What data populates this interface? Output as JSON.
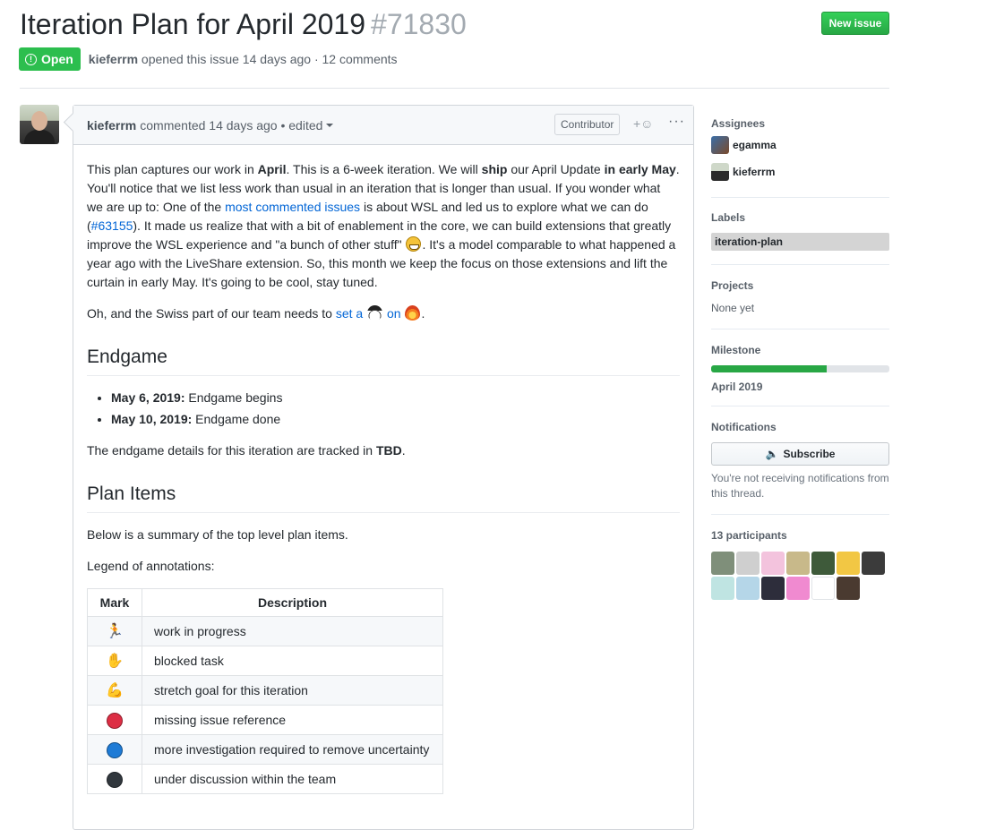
{
  "issue": {
    "title": "Iteration Plan for April 2019",
    "number": "#71830",
    "new_issue_label": "New issue",
    "state": "Open",
    "state_icon": "!",
    "author": "kieferrm",
    "opened_text": " opened this issue 14 days ago · 12 comments"
  },
  "comment": {
    "author": "kieferrm",
    "when": "commented 14 days ago • edited",
    "role_badge": "Contributor",
    "reaction_icon": "+☺",
    "menu_icon": "···",
    "p1": {
      "a": "This plan captures our work in ",
      "b": "April",
      "c": ". This is a 6-week iteration. We will ",
      "d": "ship",
      "e": " our April Update ",
      "f": "in early May",
      "g": ". You'll notice that we list less work than usual in an iteration that is longer than usual. If you wonder what we are up to: One of the ",
      "link1": "most commented issues",
      "h": " is about WSL and led us to explore what we can do (",
      "link2": "#63155",
      "i": "). It made us realize that with a bit of enablement in the core, we can build extensions that greatly improve the WSL experience and \"a bunch of other stuff\" ",
      "j": ". It's a model comparable to what happened a year ago with the LiveShare extension. So, this month we keep the focus on those extensions and lift the curtain in early May. It's going to be cool, stay tuned."
    },
    "p2": {
      "a": "Oh, and the Swiss part of our team needs to ",
      "link1": "set a",
      "link2": "on",
      "b": "."
    },
    "endgame_heading": "Endgame",
    "endgame_items": [
      {
        "date": "May 6, 2019:",
        "text": " Endgame begins"
      },
      {
        "date": "May 10, 2019:",
        "text": " Endgame done"
      }
    ],
    "endgame_note": {
      "a": "The endgame details for this iteration are tracked in ",
      "b": "TBD",
      "c": "."
    },
    "plan_heading": "Plan Items",
    "plan_summary": "Below is a summary of the top level plan items.",
    "legend_intro": "Legend of annotations:",
    "legend_headers": {
      "mark": "Mark",
      "desc": "Description"
    },
    "legend_rows": [
      {
        "icon": "running-icon",
        "glyph": "🏃",
        "color": "#ffb03a",
        "desc": "work in progress"
      },
      {
        "icon": "hand-icon",
        "glyph": "✋",
        "color": "#f5b82e",
        "desc": "blocked task"
      },
      {
        "icon": "muscle-icon",
        "glyph": "💪",
        "color": "#f5b82e",
        "desc": "stretch goal for this iteration"
      },
      {
        "icon": "red-circle-icon",
        "glyph": "",
        "color": "#dd2e44",
        "desc": "missing issue reference"
      },
      {
        "icon": "blue-circle-icon",
        "glyph": "",
        "color": "#1e7bd6",
        "desc": "more investigation required to remove uncertainty"
      },
      {
        "icon": "black-circle-icon",
        "glyph": "",
        "color": "#31373d",
        "desc": "under discussion within the team"
      }
    ]
  },
  "sidebar": {
    "assignees_label": "Assignees",
    "assignees": [
      "egamma",
      "kieferrm"
    ],
    "labels_label": "Labels",
    "label": "iteration-plan",
    "label_color": "#d4d4d4",
    "projects_label": "Projects",
    "projects_value": "None yet",
    "milestone_label": "Milestone",
    "milestone_name": "April 2019",
    "milestone_progress": 0.65,
    "notifications_label": "Notifications",
    "subscribe_label": "Subscribe",
    "notifications_text": "You're not receiving notifications from this thread.",
    "participants_label": "13 participants",
    "participant_colors": [
      "#7f8f7a",
      "#cfcfcf",
      "#f3c3dd",
      "#c8b98a",
      "#3e5a3a",
      "#f2c744",
      "#3b3b3b",
      "#bfe4e2",
      "#b5d6e8",
      "#2d2d3b",
      "#f08ad0",
      "#ffffff",
      "#4a3a30"
    ]
  },
  "colors": {
    "accent": "#0366d6",
    "open_green": "#2cbe4e",
    "new_issue_green": "#28a745"
  }
}
